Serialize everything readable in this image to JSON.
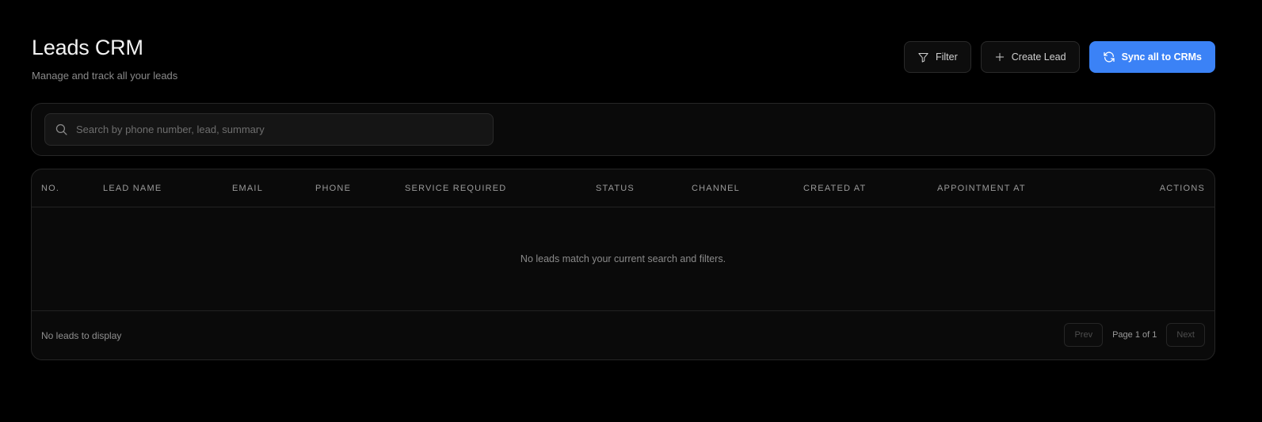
{
  "header": {
    "title": "Leads CRM",
    "subtitle": "Manage and track all your leads"
  },
  "toolbar": {
    "filter_label": "Filter",
    "filter_icon": "filter-icon",
    "create_label": "Create Lead",
    "create_icon": "plus-icon",
    "sync_label": "Sync all to CRMs",
    "sync_icon": "refresh-icon"
  },
  "search": {
    "placeholder": "Search by phone number, lead, summary",
    "value": "",
    "icon": "search-icon"
  },
  "table": {
    "columns": [
      "NO.",
      "LEAD NAME",
      "EMAIL",
      "PHONE",
      "SERVICE REQUIRED",
      "STATUS",
      "CHANNEL",
      "CREATED AT",
      "APPOINTMENT AT",
      "ACTIONS"
    ],
    "empty_message": "No leads match your current search and filters."
  },
  "footer": {
    "status": "No leads to display",
    "prev_label": "Prev",
    "page_info": "Page 1 of 1",
    "next_label": "Next"
  },
  "colors": {
    "background": "#000000",
    "accent": "#3b82f6",
    "card_border": "#262626"
  }
}
